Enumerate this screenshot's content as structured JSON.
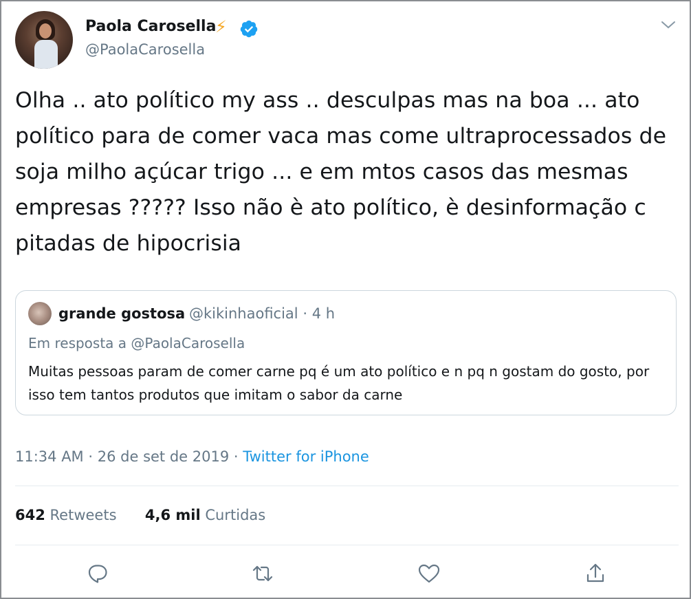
{
  "author": {
    "name": "Paola Carosella",
    "emoji": "⚡",
    "handle": "@PaolaCarosella"
  },
  "tweet": {
    "text": "Olha .. ato político my ass .. desculpas mas na boa ... ato político para de comer vaca mas come ultraprocessados de soja milho açúcar trigo ... e em mtos casos das mesmas empresas ?????  Isso não è ato político, è desinformação c pitadas de hipocrisia"
  },
  "quote": {
    "name": "grande gostosa",
    "handle": "@kikinhaoficial",
    "separator": "·",
    "time": "4 h",
    "reply_to": "Em resposta a @PaolaCarosella",
    "text": "Muitas pessoas param de comer carne pq é um ato político e n pq n gostam do gosto, por isso tem tantos produtos que imitam o sabor da carne"
  },
  "meta": {
    "time": "11:34 AM",
    "separator": "·",
    "date": "26 de set de 2019",
    "source": "Twitter for iPhone"
  },
  "stats": {
    "retweets_count": "642",
    "retweets_label": "Retweets",
    "likes_count": "4,6 mil",
    "likes_label": "Curtidas"
  },
  "icons": {
    "reply": "reply-icon",
    "retweet": "retweet-icon",
    "like": "heart-icon",
    "share": "share-icon",
    "verified": "verified-icon",
    "menu": "chevron-down-icon"
  },
  "colors": {
    "text": "#14171a",
    "secondary": "#657786",
    "link": "#1b95e0",
    "verified": "#1da1f2",
    "border": "#ccd6dd"
  }
}
